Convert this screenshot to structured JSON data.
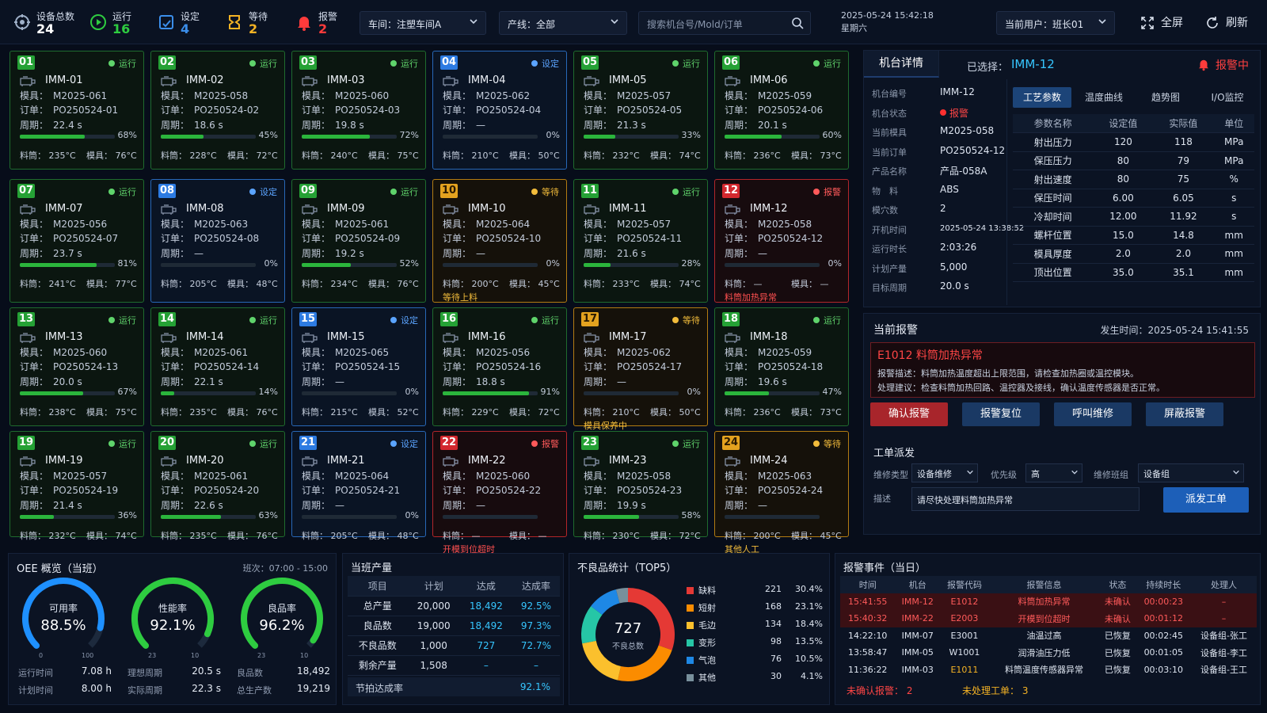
{
  "topbar": {
    "stats": [
      {
        "label": "设备总数",
        "value": "24",
        "color": "#ffffff",
        "icon": "machine-total-icon"
      },
      {
        "label": "运行",
        "value": "16",
        "color": "#2ecc40",
        "icon": "run-icon"
      },
      {
        "label": "设定",
        "value": "4",
        "color": "#3b8eea",
        "icon": "setting-icon"
      },
      {
        "label": "等待",
        "value": "2",
        "color": "#f5b324",
        "icon": "wait-icon"
      },
      {
        "label": "报警",
        "value": "2",
        "color": "#ff3b3b",
        "icon": "alarm-bell-icon"
      }
    ],
    "workshop": "车间：注塑车间A",
    "line": "产线：全部",
    "search_placeholder": "搜索机台号/Mold/订单",
    "date": "2025-05-24 15:42:18",
    "weekday": "星期六",
    "user": "当前用户：班长01",
    "fullscreen": "全屏",
    "refresh": "刷新"
  },
  "labels": {
    "mold": "模具：",
    "order": "订单：",
    "cycle": "周期：",
    "mat": "料筒：",
    "moldtemp": "模具："
  },
  "machines": [
    {
      "no": "01",
      "name": "IMM-01",
      "status": "run",
      "status_label": "运行",
      "mold": "M2025-061",
      "order": "PO250524-01",
      "cycle": "22.4 s",
      "pct": 68,
      "pct_label": "68%",
      "mat": "235°C",
      "moldt": "76°C",
      "note": ""
    },
    {
      "no": "02",
      "name": "IMM-02",
      "status": "run",
      "status_label": "运行",
      "mold": "M2025-058",
      "order": "PO250524-02",
      "cycle": "18.6 s",
      "pct": 45,
      "pct_label": "45%",
      "mat": "228°C",
      "moldt": "72°C",
      "note": ""
    },
    {
      "no": "03",
      "name": "IMM-03",
      "status": "run",
      "status_label": "运行",
      "mold": "M2025-060",
      "order": "PO250524-03",
      "cycle": "19.8 s",
      "pct": 72,
      "pct_label": "72%",
      "mat": "240°C",
      "moldt": "75°C",
      "note": ""
    },
    {
      "no": "04",
      "name": "IMM-04",
      "status": "set",
      "status_label": "设定",
      "mold": "M2025-062",
      "order": "PO250524-04",
      "cycle": "—",
      "pct": 0,
      "pct_label": "0%",
      "mat": "210°C",
      "moldt": "50°C",
      "note": ""
    },
    {
      "no": "05",
      "name": "IMM-05",
      "status": "run",
      "status_label": "运行",
      "mold": "M2025-057",
      "order": "PO250524-05",
      "cycle": "21.3 s",
      "pct": 33,
      "pct_label": "33%",
      "mat": "232°C",
      "moldt": "74°C",
      "note": ""
    },
    {
      "no": "06",
      "name": "IMM-06",
      "status": "run",
      "status_label": "运行",
      "mold": "M2025-059",
      "order": "PO250524-06",
      "cycle": "20.1 s",
      "pct": 60,
      "pct_label": "60%",
      "mat": "236°C",
      "moldt": "73°C",
      "note": ""
    },
    {
      "no": "07",
      "name": "IMM-07",
      "status": "run",
      "status_label": "运行",
      "mold": "M2025-056",
      "order": "PO250524-07",
      "cycle": "23.7 s",
      "pct": 81,
      "pct_label": "81%",
      "mat": "241°C",
      "moldt": "77°C",
      "note": ""
    },
    {
      "no": "08",
      "name": "IMM-08",
      "status": "set",
      "status_label": "设定",
      "mold": "M2025-063",
      "order": "PO250524-08",
      "cycle": "—",
      "pct": 0,
      "pct_label": "0%",
      "mat": "205°C",
      "moldt": "48°C",
      "note": ""
    },
    {
      "no": "09",
      "name": "IMM-09",
      "status": "run",
      "status_label": "运行",
      "mold": "M2025-061",
      "order": "PO250524-09",
      "cycle": "19.2 s",
      "pct": 52,
      "pct_label": "52%",
      "mat": "234°C",
      "moldt": "76°C",
      "note": ""
    },
    {
      "no": "10",
      "name": "IMM-10",
      "status": "wait",
      "status_label": "等待",
      "mold": "M2025-064",
      "order": "PO250524-10",
      "cycle": "—",
      "pct": 0,
      "pct_label": "0%",
      "mat": "200°C",
      "moldt": "45°C",
      "note": "等待上料"
    },
    {
      "no": "11",
      "name": "IMM-11",
      "status": "run",
      "status_label": "运行",
      "mold": "M2025-057",
      "order": "PO250524-11",
      "cycle": "21.6 s",
      "pct": 28,
      "pct_label": "28%",
      "mat": "233°C",
      "moldt": "74°C",
      "note": ""
    },
    {
      "no": "12",
      "name": "IMM-12",
      "status": "alarm",
      "status_label": "报警",
      "mold": "M2025-058",
      "order": "PO250524-12",
      "cycle": "—",
      "pct": 0,
      "pct_label": "0%",
      "mat": "—",
      "moldt": "—",
      "note": "料筒加热异常"
    },
    {
      "no": "13",
      "name": "IMM-13",
      "status": "run",
      "status_label": "运行",
      "mold": "M2025-060",
      "order": "PO250524-13",
      "cycle": "20.0 s",
      "pct": 67,
      "pct_label": "67%",
      "mat": "238°C",
      "moldt": "75°C",
      "note": ""
    },
    {
      "no": "14",
      "name": "IMM-14",
      "status": "run",
      "status_label": "运行",
      "mold": "M2025-061",
      "order": "PO250524-14",
      "cycle": "22.1 s",
      "pct": 14,
      "pct_label": "14%",
      "mat": "235°C",
      "moldt": "76°C",
      "note": ""
    },
    {
      "no": "15",
      "name": "IMM-15",
      "status": "set",
      "status_label": "设定",
      "mold": "M2025-065",
      "order": "PO250524-15",
      "cycle": "—",
      "pct": 0,
      "pct_label": "0%",
      "mat": "215°C",
      "moldt": "52°C",
      "note": ""
    },
    {
      "no": "16",
      "name": "IMM-16",
      "status": "run",
      "status_label": "运行",
      "mold": "M2025-056",
      "order": "PO250524-16",
      "cycle": "18.8 s",
      "pct": 91,
      "pct_label": "91%",
      "mat": "229°C",
      "moldt": "72°C",
      "note": ""
    },
    {
      "no": "17",
      "name": "IMM-17",
      "status": "wait",
      "status_label": "等待",
      "mold": "M2025-062",
      "order": "PO250524-17",
      "cycle": "—",
      "pct": 0,
      "pct_label": "0%",
      "mat": "210°C",
      "moldt": "50°C",
      "note": "模具保养中"
    },
    {
      "no": "18",
      "name": "IMM-18",
      "status": "run",
      "status_label": "运行",
      "mold": "M2025-059",
      "order": "PO250524-18",
      "cycle": "19.6 s",
      "pct": 47,
      "pct_label": "47%",
      "mat": "236°C",
      "moldt": "73°C",
      "note": ""
    },
    {
      "no": "19",
      "name": "IMM-19",
      "status": "run",
      "status_label": "运行",
      "mold": "M2025-057",
      "order": "PO250524-19",
      "cycle": "21.4 s",
      "pct": 36,
      "pct_label": "36%",
      "mat": "232°C",
      "moldt": "74°C",
      "note": ""
    },
    {
      "no": "20",
      "name": "IMM-20",
      "status": "run",
      "status_label": "运行",
      "mold": "M2025-061",
      "order": "PO250524-20",
      "cycle": "22.6 s",
      "pct": 63,
      "pct_label": "63%",
      "mat": "235°C",
      "moldt": "76°C",
      "note": ""
    },
    {
      "no": "21",
      "name": "IMM-21",
      "status": "set",
      "status_label": "设定",
      "mold": "M2025-064",
      "order": "PO250524-21",
      "cycle": "—",
      "pct": 0,
      "pct_label": "0%",
      "mat": "205°C",
      "moldt": "48°C",
      "note": ""
    },
    {
      "no": "22",
      "name": "IMM-22",
      "status": "alarm",
      "status_label": "报警",
      "mold": "M2025-060",
      "order": "PO250524-22",
      "cycle": "—",
      "pct": 0,
      "pct_label": "",
      "mat": "—",
      "moldt": "—",
      "note": "开模到位超时"
    },
    {
      "no": "23",
      "name": "IMM-23",
      "status": "run",
      "status_label": "运行",
      "mold": "M2025-058",
      "order": "PO250524-23",
      "cycle": "19.9 s",
      "pct": 58,
      "pct_label": "58%",
      "mat": "230°C",
      "moldt": "72°C",
      "note": ""
    },
    {
      "no": "24",
      "name": "IMM-24",
      "status": "wait",
      "status_label": "等待",
      "mold": "M2025-063",
      "order": "PO250524-24",
      "cycle": "—",
      "pct": 0,
      "pct_label": "",
      "mat": "200°C",
      "moldt": "45°C",
      "note": "其他人工"
    }
  ],
  "detail": {
    "tab": "机台详情",
    "selected_label": "已选择：",
    "selected": "IMM-12",
    "alarm_flag": "报警中",
    "info": [
      {
        "k": "机台编号",
        "v": "IMM-12"
      },
      {
        "k": "机台状态",
        "v": "报警"
      },
      {
        "k": "当前模具",
        "v": "M2025-058"
      },
      {
        "k": "当前订单",
        "v": "PO250524-12"
      },
      {
        "k": "产品名称",
        "v": "产品-058A"
      },
      {
        "k": "物　料",
        "v": "ABS"
      },
      {
        "k": "模穴数",
        "v": "2"
      },
      {
        "k": "开机时间",
        "v": "2025-05-24 13:38:52"
      },
      {
        "k": "运行时长",
        "v": "2:03:26"
      },
      {
        "k": "计划产量",
        "v": "5,000"
      },
      {
        "k": "目标周期",
        "v": "20.0 s"
      }
    ],
    "tabs": [
      "工艺参数",
      "温度曲线",
      "趋势图",
      "I/O监控"
    ],
    "param_headers": [
      "参数名称",
      "设定值",
      "实际值",
      "单位"
    ],
    "params": [
      [
        "射出压力",
        "120",
        "118",
        "MPa"
      ],
      [
        "保压压力",
        "80",
        "79",
        "MPa"
      ],
      [
        "射出速度",
        "80",
        "75",
        "%"
      ],
      [
        "保压时间",
        "6.00",
        "6.05",
        "s"
      ],
      [
        "冷却时间",
        "12.00",
        "11.92",
        "s"
      ],
      [
        "螺杆位置",
        "15.0",
        "14.8",
        "mm"
      ],
      [
        "模具厚度",
        "2.0",
        "2.0",
        "mm"
      ],
      [
        "顶出位置",
        "35.0",
        "35.1",
        "mm"
      ]
    ]
  },
  "current_alarm": {
    "title": "当前报警",
    "time": "发生时间：2025-05-24 15:41:55",
    "code_title": "E1012 料筒加热异常",
    "desc": "报警描述：料筒加热温度超出上限范围，请检查加热圈或温控模块。",
    "advice": "处理建议：检查料筒加热回路、温控器及接线，确认温度传感器是否正常。",
    "buttons": [
      "确认报警",
      "报警复位",
      "呼叫维修",
      "屏蔽报警"
    ]
  },
  "dispatch": {
    "title": "工单派发",
    "type_label": "维修类型",
    "type": "设备维修",
    "prio_label": "优先级",
    "prio": "高",
    "team_label": "维修班组",
    "team": "设备组",
    "desc_label": "描述",
    "desc": "请尽快处理料筒加热异常",
    "submit": "派发工单"
  },
  "oee": {
    "title": "OEE 概览（当班）",
    "shift": "班次：07:00 - 15:00",
    "gauges": [
      {
        "name": "可用率",
        "value": "88.5%",
        "pct": 88.5,
        "color": "#1e90ff",
        "min": "0",
        "max": "100"
      },
      {
        "name": "性能率",
        "value": "92.1%",
        "pct": 92.1,
        "color": "#2ecc40",
        "min": "23",
        "max": "10"
      },
      {
        "name": "良品率",
        "value": "96.2%",
        "pct": 96.2,
        "color": "#2ecc40",
        "min": "23",
        "max": "10"
      }
    ],
    "rows": [
      [
        "运行时间",
        "7.08 h",
        "理想周期",
        "20.5 s",
        "良品数",
        "18,492"
      ],
      [
        "计划时间",
        "8.00 h",
        "实际周期",
        "22.3 s",
        "总生产数",
        "19,219"
      ]
    ]
  },
  "production": {
    "title": "当班产量",
    "headers": [
      "项目",
      "计划",
      "达成",
      "达成率"
    ],
    "rows": [
      [
        "总产量",
        "20,000",
        "18,492",
        "92.5%"
      ],
      [
        "良品数",
        "19,000",
        "18,492",
        "97.3%"
      ],
      [
        "不良品数",
        "1,000",
        "727",
        "72.7%"
      ],
      [
        "剩余产量",
        "1,508",
        "–",
        "–"
      ]
    ],
    "footer_label": "节拍达成率",
    "footer_value": "92.1%"
  },
  "defects": {
    "title": "不良品统计（TOP5）",
    "total": "727",
    "total_label": "不良总数",
    "items": [
      {
        "name": "缺料",
        "count": "221",
        "pct": "30.4%",
        "value": 221,
        "color": "#e53935"
      },
      {
        "name": "短射",
        "count": "168",
        "pct": "23.1%",
        "value": 168,
        "color": "#fb8c00"
      },
      {
        "name": "毛边",
        "count": "134",
        "pct": "18.4%",
        "value": 134,
        "color": "#fbc02d"
      },
      {
        "name": "变形",
        "count": "98",
        "pct": "13.5%",
        "value": 98,
        "color": "#26c6a6"
      },
      {
        "name": "气泡",
        "count": "76",
        "pct": "10.5%",
        "value": 76,
        "color": "#1e88e5"
      },
      {
        "name": "其他",
        "count": "30",
        "pct": "4.1%",
        "value": 30,
        "color": "#78909c"
      }
    ]
  },
  "events": {
    "title": "报警事件（当日）",
    "headers": [
      "时间",
      "机台",
      "报警代码",
      "报警信息",
      "状态",
      "持续时长",
      "处理人"
    ],
    "rows": [
      {
        "cells": [
          "15:41:55",
          "IMM-12",
          "E1012",
          "料筒加热异常",
          "未确认",
          "00:00:23",
          "–"
        ],
        "red": true
      },
      {
        "cells": [
          "15:40:32",
          "IMM-22",
          "E2003",
          "开模到位超时",
          "未确认",
          "00:01:12",
          "–"
        ],
        "red": true
      },
      {
        "cells": [
          "14:22:10",
          "IMM-07",
          "E3001",
          "油温过高",
          "已恢复",
          "00:02:45",
          "设备组-张工"
        ],
        "red": false
      },
      {
        "cells": [
          "13:58:47",
          "IMM-05",
          "W1001",
          "润滑油压力低",
          "已恢复",
          "00:01:05",
          "设备组-李工"
        ],
        "red": false
      },
      {
        "cells": [
          "11:36:22",
          "IMM-03",
          "E1011",
          "料筒温度传感器异常",
          "已恢复",
          "00:03:10",
          "设备组-王工"
        ],
        "red": false
      }
    ],
    "unconfirmed_label": "未确认报警：",
    "unconfirmed": "2",
    "unhandled_label": "未处理工单：",
    "unhandled": "3"
  }
}
